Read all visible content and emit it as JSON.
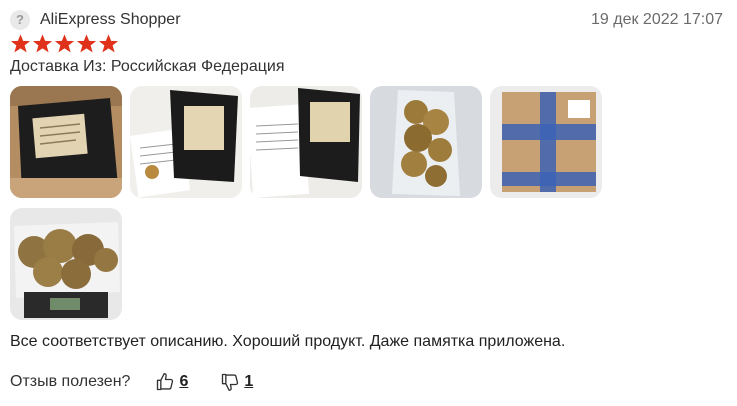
{
  "review": {
    "author_avatar_glyph": "?",
    "author": "AliExpress Shopper",
    "date": "19 дек 2022 17:07",
    "rating": 5,
    "rating_max": 5,
    "star_color": "#e0321a",
    "shipping": "Доставка Из: Российская Федерация",
    "photos": [
      {
        "icon": "photo-black-pouch-in-box"
      },
      {
        "icon": "photo-black-pouch-with-note"
      },
      {
        "icon": "photo-black-pouch-with-letter"
      },
      {
        "icon": "photo-dried-slices-in-bag"
      },
      {
        "icon": "photo-shipping-box-taped"
      },
      {
        "icon": "photo-bag-on-scale"
      }
    ],
    "text": "Все соответствует описанию. Хороший продукт. Даже памятка приложена.",
    "helpful_question": "Отзыв полезен?",
    "likes": "6",
    "dislikes": "1"
  }
}
